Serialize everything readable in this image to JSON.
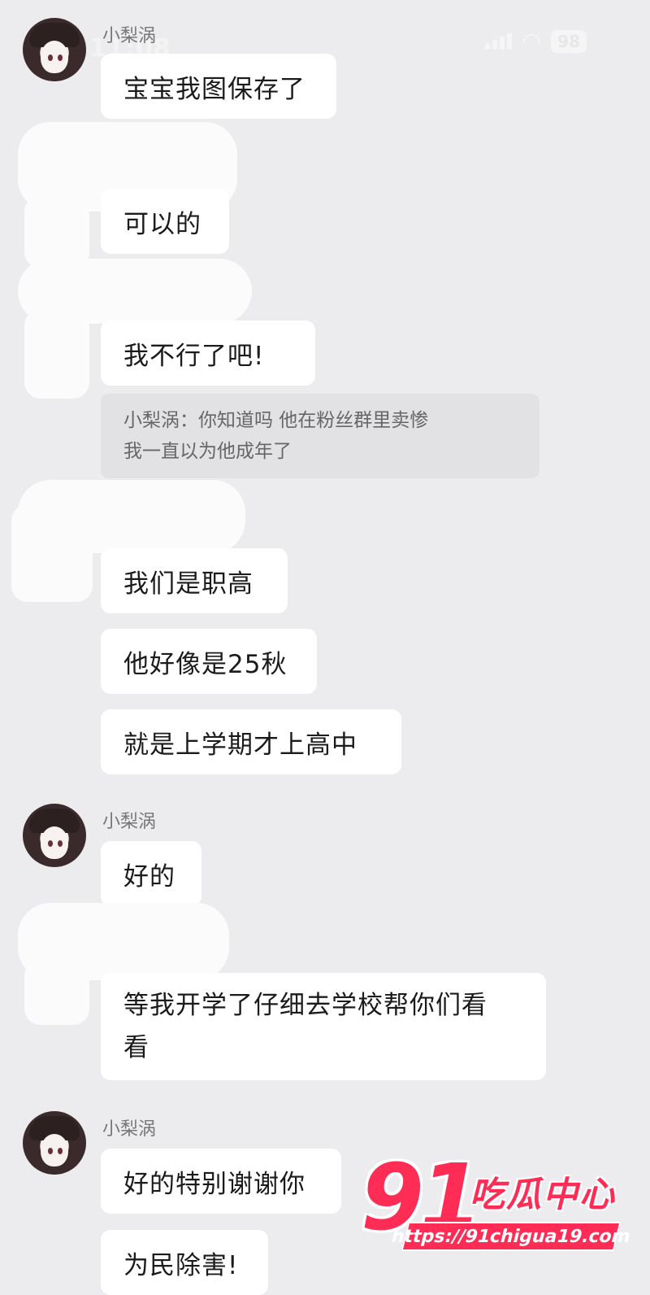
{
  "status_bar": {
    "time": "11:08",
    "battery": "98"
  },
  "messages": {
    "sender_1": "小梨涡",
    "m1": "宝宝我图保存了",
    "m2": "可以的",
    "m3": "我不行了吧!",
    "quote_line1": "小梨涡：你知道吗 他在粉丝群里卖惨",
    "quote_line2": "我一直以为他成年了",
    "m4": "我们是职高",
    "m5": "他好像是25秋",
    "m6": "就是上学期才上高中",
    "sender_2": "小梨涡",
    "m7": "好的",
    "m8_line1": "等我开学了仔细去学校帮你们看",
    "m8_line2": "看",
    "sender_3": "小梨涡",
    "m9": "好的特别谢谢你",
    "m10": "为民除害!"
  },
  "watermark": {
    "number": "91",
    "name": "吃瓜中心",
    "url": "https://91chigua19.com"
  },
  "colors": {
    "background": "#ececee",
    "bubble": "#ffffff",
    "quote": "#e2e2e5",
    "watermark": "#ff2d55"
  }
}
